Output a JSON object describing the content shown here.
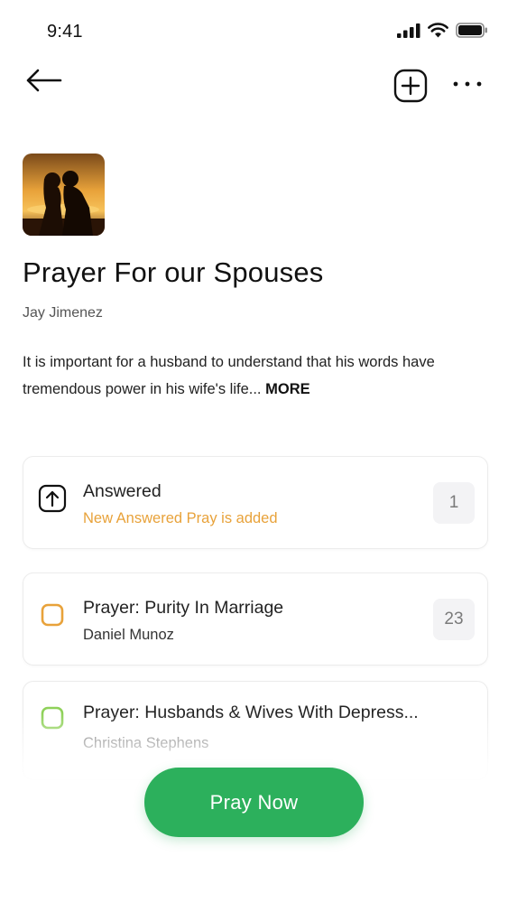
{
  "status_bar": {
    "time": "9:41"
  },
  "nav": {
    "back_icon": "arrow-left-icon",
    "add_icon": "plus-square-icon",
    "more_icon": "ellipsis-icon"
  },
  "plan": {
    "title": "Prayer For our Spouses",
    "author": "Jay Jimenez",
    "description": "It is important for a husband to understand that his words have tremendous power in his wife's life... ",
    "more_label": "MORE"
  },
  "items": [
    {
      "title": "Answered",
      "subtitle": "New Answered Pray is added",
      "count": "1",
      "icon": "arrow-up-square-icon"
    },
    {
      "title": "Prayer: Purity In Marriage",
      "subtitle": "Daniel Munoz",
      "count": "23",
      "icon": "checkbox-orange-icon"
    },
    {
      "title": "Prayer: Husbands & Wives With Depress...",
      "subtitle": "Christina Stephens",
      "icon": "checkbox-green-icon"
    }
  ],
  "primary_action": {
    "label": "Pray Now"
  },
  "colors": {
    "accent_green": "#2cb05c",
    "accent_orange": "#e8a23a",
    "check_green": "#8fd15a"
  }
}
